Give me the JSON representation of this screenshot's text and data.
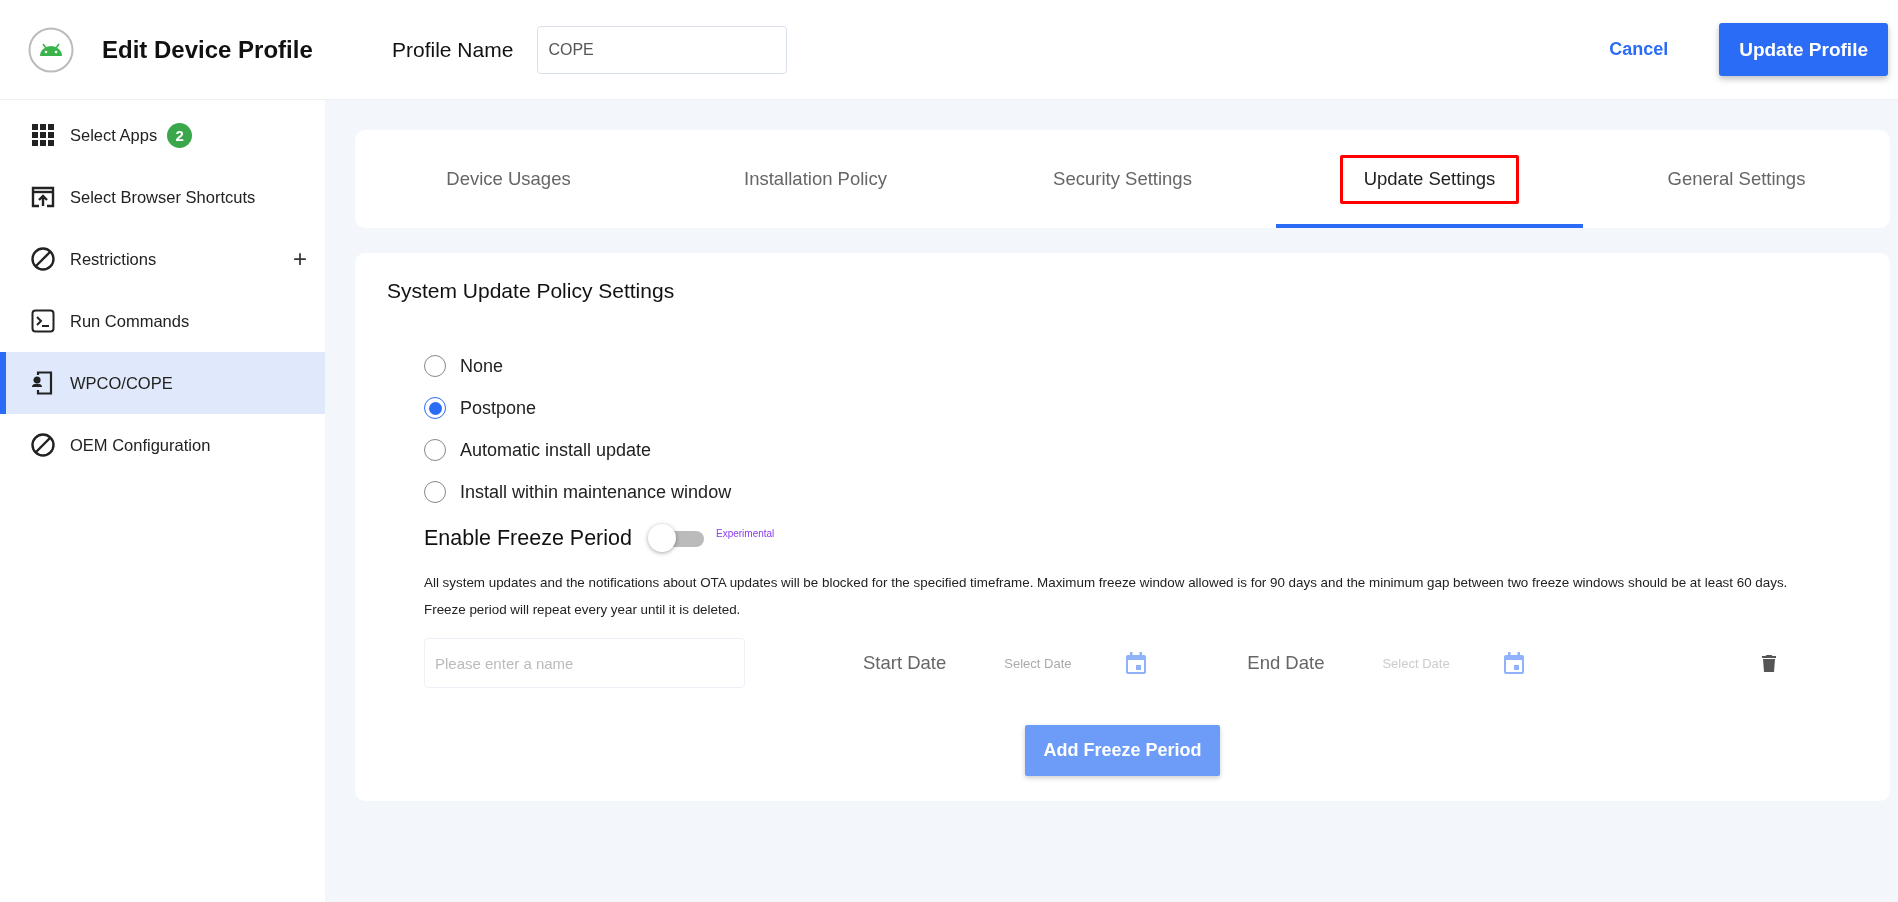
{
  "header": {
    "title": "Edit Device Profile",
    "profile_name_label": "Profile Name",
    "profile_name_value": "COPE",
    "cancel": "Cancel",
    "update": "Update Profile"
  },
  "sidebar": {
    "items": [
      {
        "label": "Select Apps",
        "kind": "grid",
        "badge": "2",
        "selected": false
      },
      {
        "label": "Select Browser Shortcuts",
        "kind": "shortcut",
        "selected": false
      },
      {
        "label": "Restrictions",
        "kind": "block",
        "action": "+",
        "selected": false
      },
      {
        "label": "Run Commands",
        "kind": "terminal",
        "selected": false
      },
      {
        "label": "WPCO/COPE",
        "kind": "phone",
        "selected": true
      },
      {
        "label": "OEM Configuration",
        "kind": "block",
        "selected": false
      }
    ]
  },
  "tabs": [
    {
      "label": "Device Usages",
      "selected": false,
      "highlighted": false
    },
    {
      "label": "Installation Policy",
      "selected": false,
      "highlighted": false
    },
    {
      "label": "Security Settings",
      "selected": false,
      "highlighted": false
    },
    {
      "label": "Update Settings",
      "selected": true,
      "highlighted": true
    },
    {
      "label": "General Settings",
      "selected": false,
      "highlighted": false
    }
  ],
  "panel": {
    "title": "System Update Policy Settings",
    "options": [
      {
        "label": "None",
        "selected": false
      },
      {
        "label": "Postpone",
        "selected": true
      },
      {
        "label": "Automatic install update",
        "selected": false
      },
      {
        "label": "Install within maintenance window",
        "selected": false
      }
    ],
    "freeze": {
      "label": "Enable Freeze Period",
      "on": false,
      "tag": "Experimental"
    },
    "description": "All system updates and the notifications about OTA updates will be blocked for the specified timeframe. Maximum freeze window allowed is for 90 days and the minimum gap between two freeze windows should be at least 60 days. Freeze period will repeat every year until it is deleted.",
    "period": {
      "name_placeholder": "Please enter a name",
      "start_label": "Start Date",
      "start_placeholder": "Select Date",
      "end_label": "End Date",
      "end_placeholder": "Select Date"
    },
    "add_button": "Add Freeze Period"
  }
}
